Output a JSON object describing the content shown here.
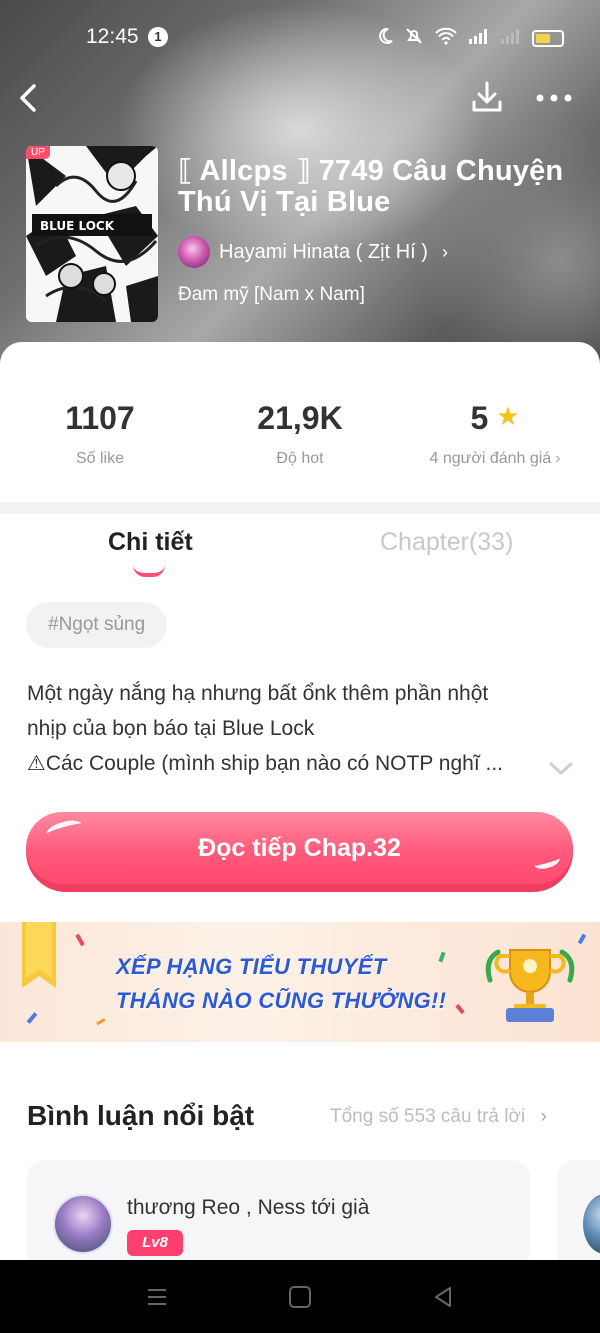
{
  "status_bar": {
    "time": "12:45",
    "notification_count": "1"
  },
  "header": {
    "cover_badge": "UP",
    "title": "⟦ Allcps ⟧ 7749 Câu Chuyện Thú Vị Tại Blue",
    "author": "Hayami Hinata ( Zịt Hí )",
    "genre": "Đam mỹ [Nam x Nam]"
  },
  "stats": {
    "likes": {
      "value": "1107",
      "label": "Số like"
    },
    "hot": {
      "value": "21,9K",
      "label": "Độ hot"
    },
    "rating": {
      "value": "5",
      "label": "4 người đánh giá"
    }
  },
  "tabs": [
    {
      "label": "Chi tiết",
      "active": true
    },
    {
      "label": "Chapter(33)",
      "active": false
    }
  ],
  "tag": "#Ngọt sủng",
  "description": {
    "line1": "Một ngày nắng hạ nhưng bất ổnk thêm phần nhột",
    "line2": "nhịp của bọn báo tại Blue Lock",
    "line3": "⚠Các Couple (mình ship bạn nào có NOTP nghĩ ..."
  },
  "read_button": "Đọc tiếp Chap.32",
  "banner": {
    "line1": "XẾP HẠNG TIỂU THUYẾT",
    "line2": "THÁNG NÀO CŨNG THƯỞNG!!"
  },
  "comments": {
    "title": "Bình luận nổi bật",
    "total": "Tổng số 553 câu trả lời",
    "items": [
      {
        "user": "thương Reo , Ness tới già",
        "level": "Lv8"
      }
    ]
  },
  "colors": {
    "accent": "#ff4d7a",
    "button": "#ff5a7b",
    "star": "#f6c21c",
    "banner_text": "#2b59d9"
  },
  "icons": {
    "back": "back-icon",
    "download": "download-icon",
    "more": "more-icon",
    "star": "star-icon",
    "chevron": "chevron-right-icon",
    "expand": "chevron-down-icon"
  }
}
